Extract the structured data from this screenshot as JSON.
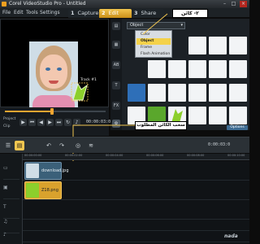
{
  "window": {
    "title": "Corel VideoStudio Pro - Untitled"
  },
  "menu": [
    "File",
    "Edit",
    "Tools",
    "Settings"
  ],
  "steps": [
    {
      "num": "1",
      "label": "Capture"
    },
    {
      "num": "2",
      "label": "Edit"
    },
    {
      "num": "3",
      "label": "Share"
    }
  ],
  "preview": {
    "overlay_label": "Track #1",
    "mode_project": "Project",
    "mode_clip": "Clip",
    "timecode": "00:00:03:00"
  },
  "library": {
    "folder_label": "Object",
    "dropdown_options": [
      "Color",
      "Object",
      "Frame",
      "Flash Animation"
    ],
    "selected_option": "Object",
    "options_label": "Options"
  },
  "annotations": {
    "step_label": "٢- كائن",
    "drag_label": "سحب الكائن المطلوب"
  },
  "timeline": {
    "timecode": "0:00:03:0",
    "ruler": [
      "00:00:00:00",
      "00:00:02:00",
      "00:00:04:00",
      "00:00:06:00",
      "00:00:08:00",
      "00:00:10:00"
    ],
    "clips": [
      {
        "name": "download.jpg",
        "track": "video"
      },
      {
        "name": "Z18.png",
        "track": "overlay"
      }
    ]
  },
  "brand": {
    "logo_text": "nada"
  },
  "colors": {
    "accent": "#f2c650",
    "overlay_clip": "#d9a22d",
    "video_clip": "#3b6079"
  }
}
